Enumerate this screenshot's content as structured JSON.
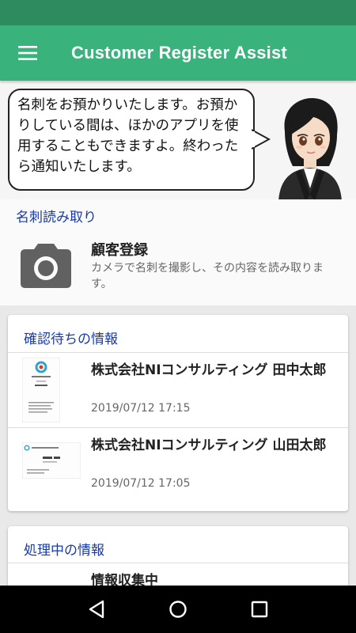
{
  "app_bar": {
    "title": "Customer Register Assist",
    "menu_icon": "hamburger-menu-icon"
  },
  "assistant": {
    "message": "名刺をお預かりいたします。お預かりしている間は、ほかのアプリを使用することもできますよ。終わったら通知いたします。",
    "avatar": "assistant-avatar"
  },
  "scan_section": {
    "heading": "名刺読み取り",
    "title": "顧客登録",
    "description": "カメラで名刺を撮影し、その内容を読み取ります。",
    "icon": "camera-icon"
  },
  "pending_section": {
    "heading": "確認待ちの情報",
    "items": [
      {
        "name": "株式会社NIコンサルティング 田中太郎",
        "date": "2019/07/12 17:15"
      },
      {
        "name": "株式会社NIコンサルティング 山田太郎",
        "date": "2019/07/12 17:05"
      }
    ]
  },
  "processing_section": {
    "heading": "処理中の情報",
    "items": [
      {
        "name": "情報収集中"
      }
    ]
  },
  "nav_bar": {
    "back_icon": "back-triangle-icon",
    "home_icon": "home-circle-icon",
    "recents_icon": "recents-square-icon"
  },
  "colors": {
    "status_bar": "#2e8b60",
    "app_bar": "#3ab27c",
    "section_heading": "#1a3aa8"
  }
}
